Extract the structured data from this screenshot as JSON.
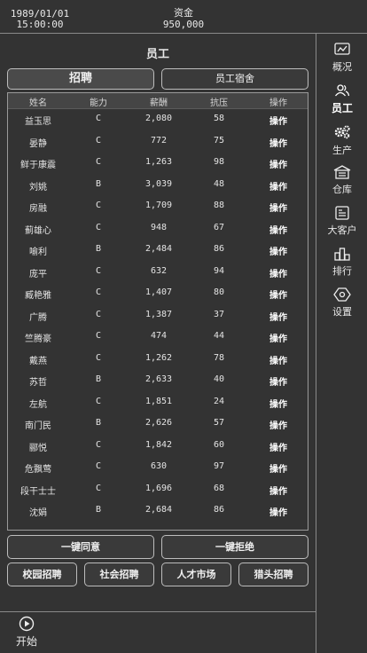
{
  "header": {
    "date": "1989/01/01",
    "time": "15:00:00",
    "funds_label": "资金",
    "funds_value": "950,000"
  },
  "page_title": "员工",
  "tabs": {
    "recruit": "招聘",
    "dorm": "员工宿舍"
  },
  "table": {
    "headers": [
      "姓名",
      "能力",
      "薪酬",
      "抗压",
      "操作"
    ],
    "rows": [
      {
        "name": "益玉思",
        "ability": "C",
        "salary": "2,080",
        "stress": "58",
        "op": "操作"
      },
      {
        "name": "晏静",
        "ability": "C",
        "salary": "772",
        "stress": "75",
        "op": "操作"
      },
      {
        "name": "鲜于康震",
        "ability": "C",
        "salary": "1,263",
        "stress": "98",
        "op": "操作"
      },
      {
        "name": "刘姚",
        "ability": "B",
        "salary": "3,039",
        "stress": "48",
        "op": "操作"
      },
      {
        "name": "房融",
        "ability": "C",
        "salary": "1,709",
        "stress": "88",
        "op": "操作"
      },
      {
        "name": "蓟雄心",
        "ability": "C",
        "salary": "948",
        "stress": "67",
        "op": "操作"
      },
      {
        "name": "喻利",
        "ability": "B",
        "salary": "2,484",
        "stress": "86",
        "op": "操作"
      },
      {
        "name": "庞平",
        "ability": "C",
        "salary": "632",
        "stress": "94",
        "op": "操作"
      },
      {
        "name": "臧艳雅",
        "ability": "C",
        "salary": "1,407",
        "stress": "80",
        "op": "操作"
      },
      {
        "name": "广腾",
        "ability": "C",
        "salary": "1,387",
        "stress": "37",
        "op": "操作"
      },
      {
        "name": "竺腾豪",
        "ability": "C",
        "salary": "474",
        "stress": "44",
        "op": "操作"
      },
      {
        "name": "戴燕",
        "ability": "C",
        "salary": "1,262",
        "stress": "78",
        "op": "操作"
      },
      {
        "name": "苏哲",
        "ability": "B",
        "salary": "2,633",
        "stress": "40",
        "op": "操作"
      },
      {
        "name": "左航",
        "ability": "C",
        "salary": "1,851",
        "stress": "24",
        "op": "操作"
      },
      {
        "name": "南门民",
        "ability": "B",
        "salary": "2,626",
        "stress": "57",
        "op": "操作"
      },
      {
        "name": "郦悦",
        "ability": "C",
        "salary": "1,842",
        "stress": "60",
        "op": "操作"
      },
      {
        "name": "危飘莺",
        "ability": "C",
        "salary": "630",
        "stress": "97",
        "op": "操作"
      },
      {
        "name": "段干士士",
        "ability": "C",
        "salary": "1,696",
        "stress": "68",
        "op": "操作"
      },
      {
        "name": "沈娟",
        "ability": "B",
        "salary": "2,684",
        "stress": "86",
        "op": "操作"
      }
    ]
  },
  "actions": {
    "agree_all": "一键同意",
    "reject_all": "一键拒绝"
  },
  "recruit_types": [
    "校园招聘",
    "社会招聘",
    "人才市场",
    "猎头招聘"
  ],
  "sidebar": [
    {
      "label": "概况",
      "icon": "chart-icon"
    },
    {
      "label": "员工",
      "icon": "people-icon"
    },
    {
      "label": "生产",
      "icon": "gears-icon"
    },
    {
      "label": "仓库",
      "icon": "warehouse-icon"
    },
    {
      "label": "大客户",
      "icon": "client-icon"
    },
    {
      "label": "排行",
      "icon": "ranking-icon"
    },
    {
      "label": "设置",
      "icon": "settings-icon"
    }
  ],
  "start_label": "开始"
}
